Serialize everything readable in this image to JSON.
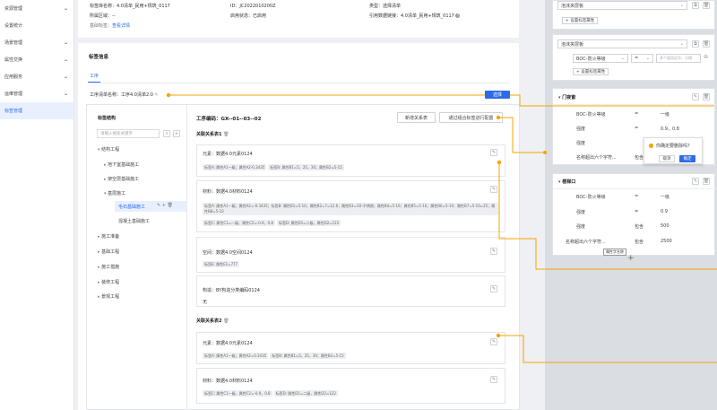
{
  "sidebar": {
    "items": [
      {
        "label": "资源管理",
        "chevron": true
      },
      {
        "label": "设置统计",
        "chevron": false
      },
      {
        "label": "场景管理",
        "chevron": true
      },
      {
        "label": "属性交换",
        "chevron": true
      },
      {
        "label": "应用服务",
        "chevron": true
      },
      {
        "label": "运维管理",
        "chevron": true
      },
      {
        "label": "标签管理",
        "chevron": false,
        "active": true
      }
    ]
  },
  "info": {
    "r1c1": "标签库名称：4.0清单_民用+规筑_0117",
    "r1c2": "ID：JC2022010200Z",
    "r1c3": "类型：选择清单",
    "r2c1": "所属区域：--",
    "r2c2": "启用状态：已启用",
    "r2c3": "引用数据链接：4.0清单_民用+规筑_0117",
    "r3c1_k": "基础标签：",
    "r3c1_v": "查看详情"
  },
  "section_title": "标签信息",
  "tab_label": "工序",
  "process_name": "工序清单名称：工序4.0清单2.0",
  "tree": {
    "title": "标签结构",
    "search_placeholder": "请输入搜索关键字",
    "items": [
      "结构工程",
      "地下室基础施工",
      "架空层基础施工",
      "基层施工",
      "毛石基础施工",
      "混凝土基础施工",
      "施工准备",
      "基础工程",
      "施工措施",
      "装修工程",
      "景观工程"
    ]
  },
  "detail": {
    "code": "工序编码：GX--01--03--02",
    "btn_new": "新增关系表",
    "btn_config": "通过组合标签进行配置",
    "rel1": "关联关系表1",
    "rel2": "关联关系表2",
    "blocks": [
      {
        "label": "元素：数据4.0元素0124",
        "tags": [
          "标签A: 属性A1—级；属性A2-0.3435",
          "标签B: 属性B1=5，25，30；属性B2=5-15"
        ]
      },
      {
        "label": "材料：数据4.0材料0124",
        "tags": [
          "标签A: 属性A1—级；属性A2=-0.3435",
          "标签B: 属性B1=5-10；属性B2=7=12.6；属性B3=1D-不锈钢；属性B4=5-10；属性B5=5-10；属性B6=5-10；属性B7=5-10=25；属性B8=5-10"
        ],
        "tags2": [
          "标签C: 属性C1=—级，属性C2=-0.9，0.8",
          "标签D: 属性D1=二级，属性D2=122"
        ]
      },
      {
        "label": "空间：数据4.0空间0124",
        "tags": [
          "标签E: 属性E1=777"
        ]
      },
      {
        "label": "构造：BY构造分类编码0124",
        "extra": "无"
      }
    ],
    "blocks2": [
      {
        "label": "元素：数据4.0元素0124",
        "tags": [
          "标签A: 属性A1—级；属性A2=0.3435",
          "标签B: 属性B1=5，25，30；属性B2=5-15"
        ]
      },
      {
        "label": "材料：数据4.0材料0124",
        "tags": [
          "标签C: 属性C1—级，属性C2=-0.9，0.8",
          "标签D: 属性D1=二级，属性D2=122"
        ]
      }
    ]
  },
  "right": {
    "select1": "泡沫夹层板",
    "add_prop": "设置标签属性",
    "select2": "泡沫夹层板",
    "cond_field": "BOC-防火等级",
    "cond_op": "=",
    "cond_placeholder": "多个值用逗号，分隔",
    "add_prop2": "设置标签属性",
    "door": {
      "title": "门夜窗",
      "rows": [
        {
          "k": "BOC-防火等级",
          "op": "=",
          "v": "一级"
        },
        {
          "k": "强度",
          "op": "=",
          "v": "0.9，0.8"
        },
        {
          "k": "强度",
          "op": "",
          "v": ""
        },
        {
          "k": "名称超出六个字符...",
          "op": "包含",
          "v": ""
        }
      ]
    },
    "popconfirm": {
      "text": "你确定要删除吗？",
      "cancel": "取消",
      "confirm": "确定"
    },
    "stair": {
      "title": "楼梯口",
      "rows": [
        {
          "k": "BOC-防火等级",
          "op": "=",
          "v": "一级"
        },
        {
          "k": "强度",
          "op": "=",
          "v": "0.9"
        },
        {
          "k": "强度",
          "op": "包含",
          "v": "500"
        },
        {
          "k": "名称超出六个字符...",
          "op": "包含",
          "v": "2500"
        }
      ],
      "tooltip": "属性字名称"
    },
    "plus": "+"
  },
  "float_btn": "选择",
  "colors": {
    "accent": "#2e6be6",
    "orange": "#f6a400"
  }
}
